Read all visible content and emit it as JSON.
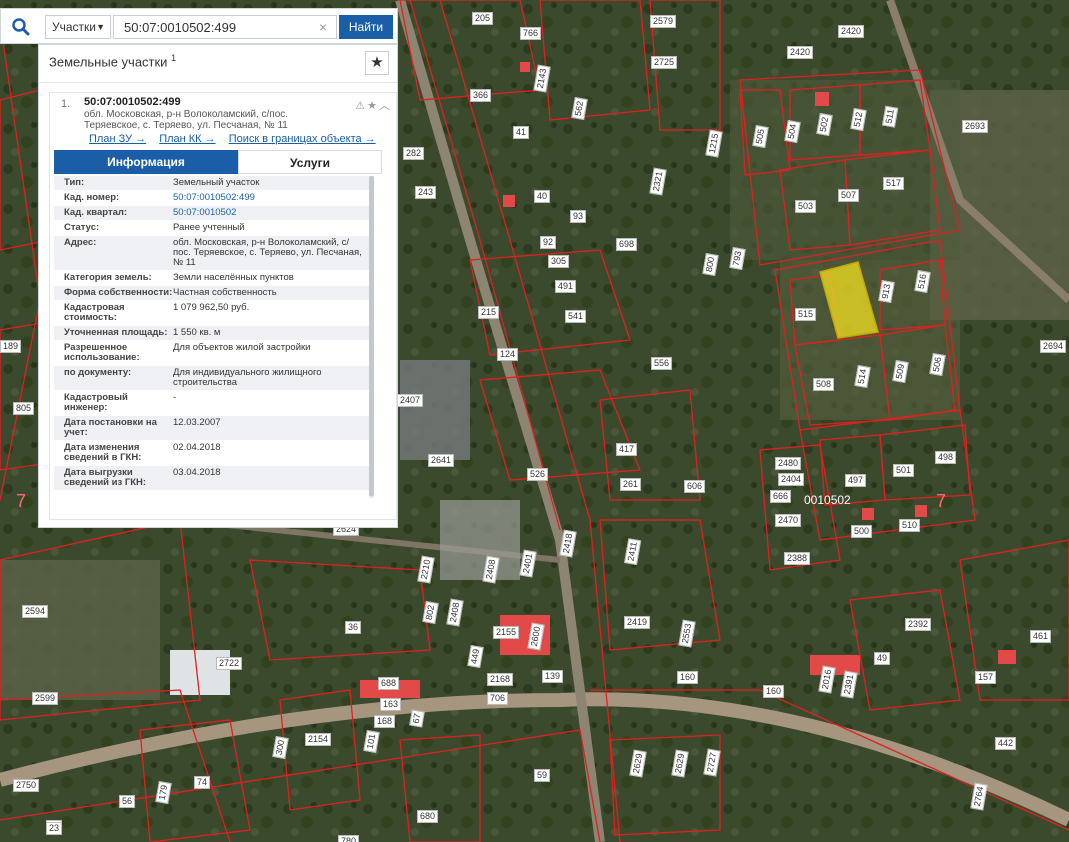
{
  "search": {
    "category": "Участки",
    "query": "50:07:0010502:499",
    "find_label": "Найти"
  },
  "panel": {
    "title": "Земельные участки",
    "count_sup": "1",
    "result": {
      "index": "1.",
      "cadastral_number": "50:07:0010502:499",
      "address": "обл. Московская, р-н Волоколамский, с/пос. Теряевское, с. Теряево, ул. Песчаная, № 11",
      "links": [
        "План ЗУ →",
        "План КК →",
        "Поиск в границах объекта →"
      ]
    },
    "tabs": {
      "info": "Информация",
      "services": "Услуги"
    },
    "rows": [
      {
        "k": "Тип:",
        "v": "Земельный участок"
      },
      {
        "k": "Кад. номер:",
        "v": "50:07:0010502:499",
        "link": true
      },
      {
        "k": "Кад. квартал:",
        "v": "50:07:0010502",
        "link": true
      },
      {
        "k": "Статус:",
        "v": "Ранее учтенный"
      },
      {
        "k": "Адрес:",
        "v": "обл. Московская, р-н Волоколамский, с/пос. Теряевское, с. Теряево, ул. Песчаная, № 11"
      },
      {
        "k": "Категория земель:",
        "v": "Земли населённых пунктов"
      },
      {
        "k": "Форма собственности:",
        "v": "Частная собственность"
      },
      {
        "k": "Кадастровая стоимость:",
        "v": "1 079 962,50 руб."
      },
      {
        "k": "Уточненная площадь:",
        "v": "1 550 кв. м"
      },
      {
        "k": "Разрешенное использование:",
        "v": "Для объектов жилой застройки"
      },
      {
        "k": "по документу:",
        "v": "Для индивидуального жилищного строительства"
      },
      {
        "k": "Кадастровый инженер:",
        "v": "-"
      },
      {
        "k": "Дата постановки на учет:",
        "v": "12.03.2007"
      },
      {
        "k": "Дата изменения сведений в ГКН:",
        "v": "02.04.2018"
      },
      {
        "k": "Дата выгрузки сведений из ГКН:",
        "v": "03.04.2018"
      }
    ]
  },
  "map": {
    "block_label": "0010502",
    "zone_labels": [
      "7",
      "7"
    ],
    "plots": [
      "205",
      "766",
      "2579",
      "2420",
      "2420",
      "2143",
      "2725",
      "366",
      "41",
      "562",
      "1215",
      "282",
      "243",
      "2321",
      "40",
      "93",
      "2693",
      "505",
      "504",
      "502",
      "512",
      "511",
      "507",
      "517",
      "498",
      "503",
      "92",
      "305",
      "698",
      "800",
      "793",
      "189",
      "2694",
      "491",
      "215",
      "541",
      "515",
      "913",
      "516",
      "124",
      "556",
      "508",
      "514",
      "509",
      "506",
      "805",
      "2407",
      "417",
      "2641",
      "526",
      "261",
      "606",
      "2480",
      "2404",
      "666",
      "497",
      "501",
      "498",
      "2470",
      "500",
      "510",
      "2624",
      "2418",
      "2411",
      "2210",
      "2408",
      "2401",
      "2388",
      "2594",
      "802",
      "2408",
      "2155",
      "2600",
      "2419",
      "2553",
      "2392",
      "36",
      "461",
      "2722",
      "449",
      "2168",
      "139",
      "160",
      "160",
      "49",
      "2391",
      "2016",
      "157",
      "2599",
      "688",
      "163",
      "168",
      "67",
      "101",
      "2154",
      "706",
      "300",
      "442",
      "2750",
      "53",
      "56",
      "179",
      "74",
      "59",
      "2629",
      "2629",
      "2727",
      "2764",
      "680",
      "780",
      "23",
      "510"
    ],
    "colors": {
      "boundary": "#e02020",
      "selected_fill": "#f0e020",
      "selected_stroke": "#c8a800",
      "road": "#b7a38a"
    }
  }
}
